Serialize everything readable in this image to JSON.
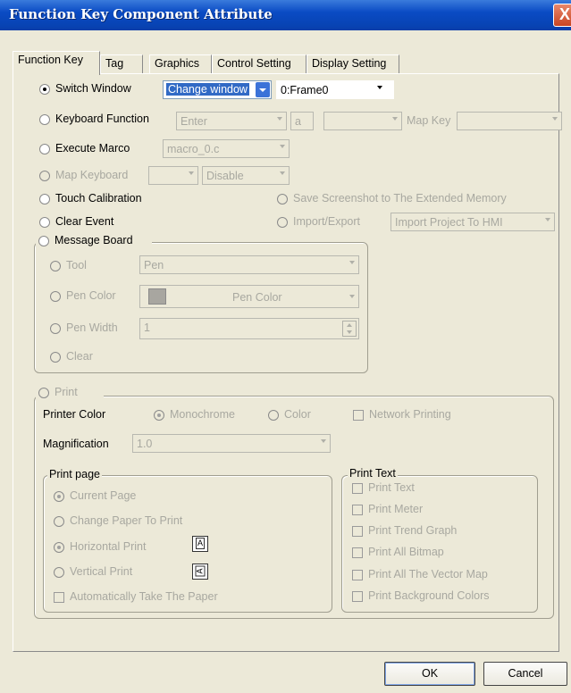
{
  "window": {
    "title": "Function Key Component Attribute",
    "close_glyph": "X"
  },
  "tabs": [
    {
      "label": "Function Key",
      "active": true
    },
    {
      "label": "Tag"
    },
    {
      "label": "Graphics"
    },
    {
      "label": "Control Setting"
    },
    {
      "label": "Display Setting"
    }
  ],
  "function_key": {
    "switch_window": {
      "label": "Switch Window",
      "selected": true,
      "mode": "Change window",
      "target": "0:Frame0"
    },
    "keyboard_function": {
      "label": "Keyboard Function",
      "key": "Enter",
      "char": "a",
      "map_key_label": "Map Key",
      "extra": "",
      "map_key_value": ""
    },
    "execute_macro": {
      "label": "Execute Marco",
      "macro": "macro_0.c"
    },
    "map_keyboard": {
      "label": "Map Keyboard",
      "value": "",
      "state": "Disable"
    },
    "touch_calibration": {
      "label": "Touch Calibration"
    },
    "save_screenshot": {
      "label": "Save Screenshot to The Extended Memory"
    },
    "clear_event": {
      "label": "Clear Event"
    },
    "import_export": {
      "label": "Import/Export",
      "value": "Import Project To HMI"
    },
    "message_board": {
      "label": "Message Board",
      "tool": {
        "label": "Tool",
        "value": "Pen"
      },
      "pen_color": {
        "label": "Pen Color",
        "value": "Pen Color"
      },
      "pen_width": {
        "label": "Pen Width",
        "value": "1"
      },
      "clear": {
        "label": "Clear"
      }
    },
    "print": {
      "label": "Print",
      "printer_color_label": "Printer Color",
      "monochrome": "Monochrome",
      "color": "Color",
      "network_printing": "Network Printing",
      "magnification_label": "Magnification",
      "magnification_value": "1.0",
      "print_page": {
        "title": "Print page",
        "current_page": "Current Page",
        "change_paper": "Change Paper To Print",
        "horizontal": "Horizontal Print",
        "vertical": "Vertical Print",
        "auto_take": "Automatically Take The Paper"
      },
      "print_text": {
        "title": "Print Text",
        "items": [
          "Print Text",
          "Print Meter",
          "Print Trend Graph",
          "Print All Bitmap",
          "Print All The Vector Map",
          "Print Background Colors"
        ]
      }
    }
  },
  "buttons": {
    "ok": "OK",
    "cancel": "Cancel"
  }
}
